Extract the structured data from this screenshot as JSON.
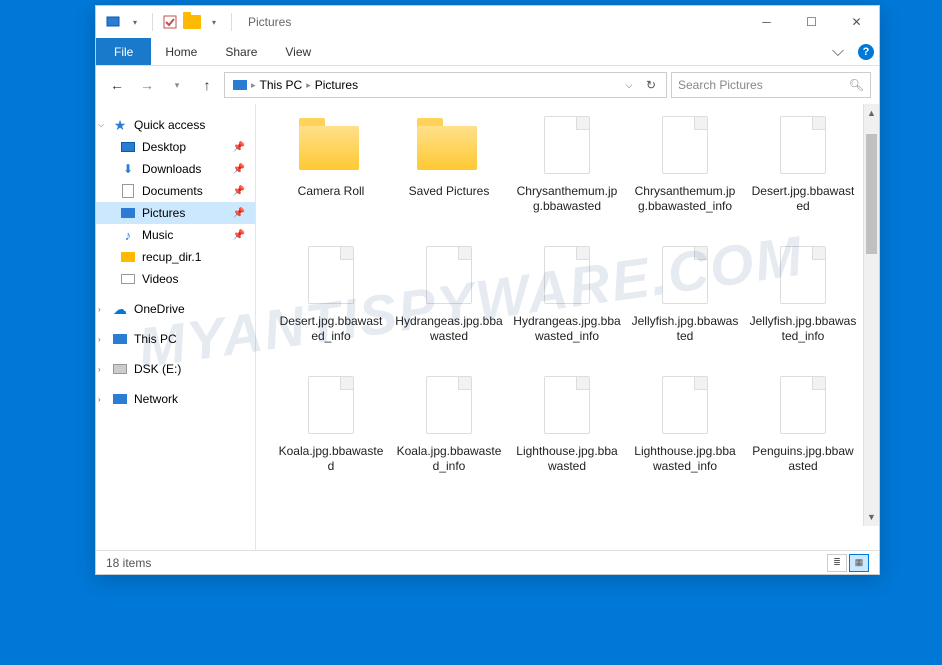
{
  "titlebar": {
    "title": "Pictures"
  },
  "ribbon": {
    "file": "File",
    "tabs": [
      "Home",
      "Share",
      "View"
    ]
  },
  "address": {
    "crumbs": [
      "This PC",
      "Pictures"
    ]
  },
  "search": {
    "placeholder": "Search Pictures"
  },
  "sidebar": {
    "quick_access": "Quick access",
    "quick_items": [
      {
        "label": "Desktop",
        "pinned": true
      },
      {
        "label": "Downloads",
        "pinned": true
      },
      {
        "label": "Documents",
        "pinned": true
      },
      {
        "label": "Pictures",
        "pinned": true,
        "selected": true
      },
      {
        "label": "Music",
        "pinned": true
      },
      {
        "label": "recup_dir.1",
        "pinned": false
      },
      {
        "label": "Videos",
        "pinned": false
      }
    ],
    "onedrive": "OneDrive",
    "thispc": "This PC",
    "drive": "DSK (E:)",
    "network": "Network"
  },
  "items": [
    {
      "name": "Camera Roll",
      "type": "folder"
    },
    {
      "name": "Saved Pictures",
      "type": "folder"
    },
    {
      "name": "Chrysanthemum.jpg.bbawasted",
      "type": "file"
    },
    {
      "name": "Chrysanthemum.jpg.bbawasted_info",
      "type": "file"
    },
    {
      "name": "Desert.jpg.bbawasted",
      "type": "file"
    },
    {
      "name": "Desert.jpg.bbawasted_info",
      "type": "file"
    },
    {
      "name": "Hydrangeas.jpg.bbawasted",
      "type": "file"
    },
    {
      "name": "Hydrangeas.jpg.bbawasted_info",
      "type": "file"
    },
    {
      "name": "Jellyfish.jpg.bbawasted",
      "type": "file"
    },
    {
      "name": "Jellyfish.jpg.bbawasted_info",
      "type": "file"
    },
    {
      "name": "Koala.jpg.bbawasted",
      "type": "file"
    },
    {
      "name": "Koala.jpg.bbawasted_info",
      "type": "file"
    },
    {
      "name": "Lighthouse.jpg.bbawasted",
      "type": "file"
    },
    {
      "name": "Lighthouse.jpg.bbawasted_info",
      "type": "file"
    },
    {
      "name": "Penguins.jpg.bbawasted",
      "type": "file"
    }
  ],
  "statusbar": {
    "count": "18 items"
  },
  "watermark": "MYANTISPYWARE.COM"
}
